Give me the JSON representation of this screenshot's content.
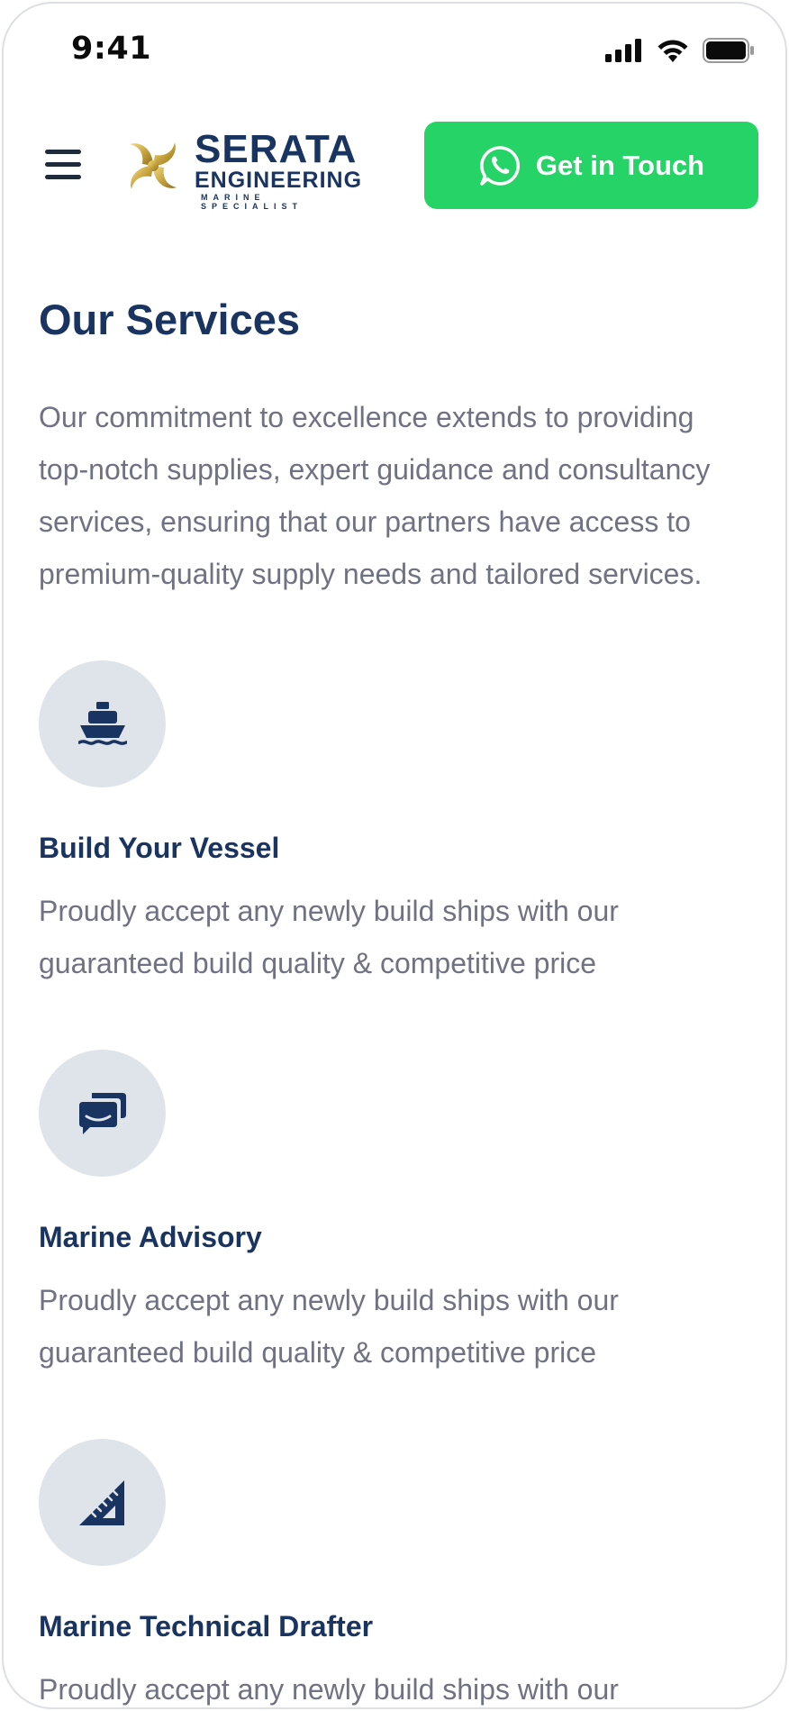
{
  "status_bar": {
    "time": "9:41"
  },
  "header": {
    "menu_icon": "hamburger-icon",
    "logo": {
      "title": "SERATA",
      "subtitle": "ENGINEERING",
      "tagline": "MARINE SPECIALIST"
    },
    "cta": {
      "label": "Get in Touch",
      "icon": "whatsapp-icon",
      "color": "#25d366"
    }
  },
  "main": {
    "title": "Our Services",
    "description": "Our commitment to excellence extends to providing top-notch supplies, expert guidance and consultancy services, ensuring that our partners have access to premium-quality supply needs and tailored services.",
    "services": [
      {
        "icon": "ship-icon",
        "title": "Build Your Vessel",
        "description": "Proudly accept any newly build ships with our guaranteed build quality & competitive price"
      },
      {
        "icon": "chat-bubbles-icon",
        "title": "Marine Advisory",
        "description": "Proudly accept any newly build ships with our guaranteed build quality & competitive price"
      },
      {
        "icon": "ruler-triangle-icon",
        "title": "Marine Technical Drafter",
        "description": "Proudly accept any newly build ships with our guaranteed build quality & competitive price"
      }
    ]
  },
  "colors": {
    "brand_navy": "#1a3461",
    "body_text": "#6f7283",
    "icon_bg": "#dfe3ea",
    "whatsapp_green": "#25d366"
  }
}
